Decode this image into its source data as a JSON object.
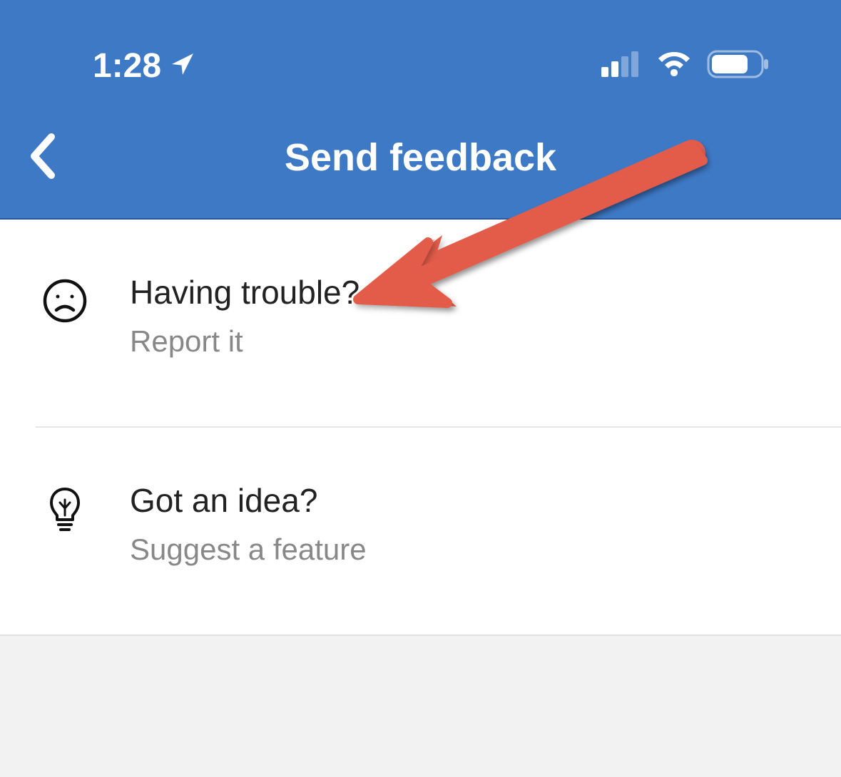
{
  "status_bar": {
    "time": "1:28"
  },
  "header": {
    "title": "Send feedback"
  },
  "items": [
    {
      "title": "Having trouble?",
      "subtitle": "Report it"
    },
    {
      "title": "Got an idea?",
      "subtitle": "Suggest a feature"
    }
  ]
}
